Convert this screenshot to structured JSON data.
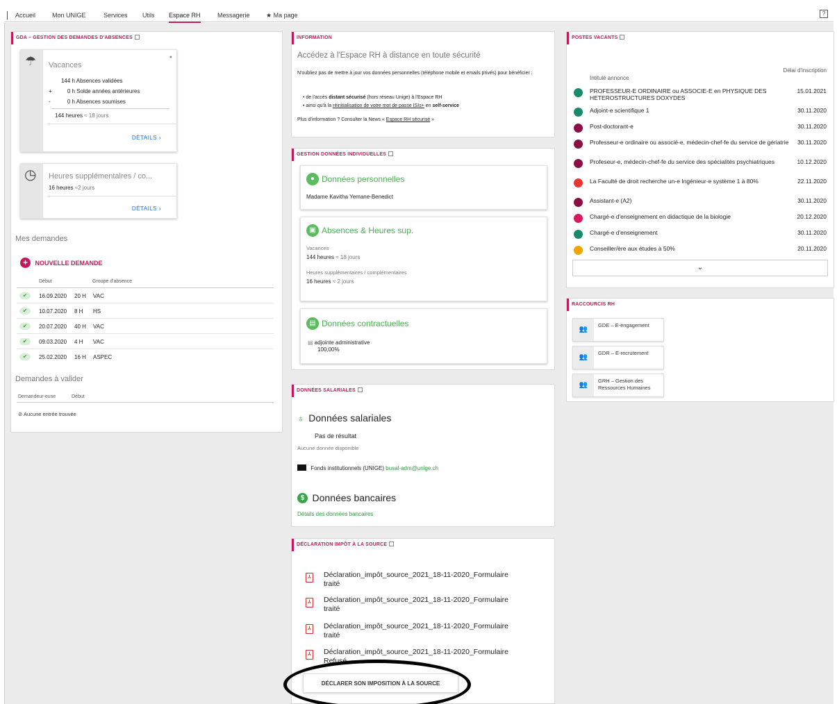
{
  "nav": {
    "items": [
      "Accueil",
      "Mon UNIGE",
      "Services",
      "Utils",
      "Espace RH",
      "Messagerie",
      "Ma page"
    ],
    "active": "Espace RH",
    "help_glyph": "?"
  },
  "gda": {
    "title": "GDA – GESTION DES DEMANDES D'ABSENCES",
    "vacances": {
      "title": "Vacances",
      "lines": [
        {
          "sign": "",
          "value": "144 h",
          "label": "Absences validées"
        },
        {
          "sign": "+",
          "value": "0 h",
          "label": "Solde années antérieures"
        },
        {
          "sign": "-",
          "value": "0 h",
          "label": "Absences soumises"
        }
      ],
      "total_hours": "144 heures",
      "total_days": "≈ 18 jours",
      "details": "DÉTAILS"
    },
    "heures": {
      "title": "Heures supplémentaires / co...",
      "hours": "16 heures",
      "days": "≈2 jours",
      "details": "DÉTAILS"
    },
    "mes_demandes": "Mes demandes",
    "nouvelle_demande": "NOUVELLE DEMANDE",
    "columns": [
      "Début",
      "Groupe d'absence"
    ],
    "rows": [
      {
        "date": "16.09.2020",
        "hours": "20 H",
        "group": "VAC"
      },
      {
        "date": "10.07.2020",
        "hours": "8 H",
        "group": "HS"
      },
      {
        "date": "20.07.2020",
        "hours": "40 H",
        "group": "VAC"
      },
      {
        "date": "09.03.2020",
        "hours": "4 H",
        "group": "VAC"
      },
      {
        "date": "25.02.2020",
        "hours": "16 H",
        "group": "ASPEC"
      }
    ],
    "a_valider": "Demandes à valider",
    "valider_columns": [
      "Demandeur-euse",
      "Début"
    ],
    "aucune": "Aucune entrée trouvée"
  },
  "information": {
    "title": "INFORMATION",
    "heading": "Accédez à l'Espace RH à distance en toute sécurité",
    "para": "N'oubliez pas de mettre à jour vos données personnelles (téléphone mobile et emails privés) pour bénéficier :",
    "bullet1_pre": "de l'accès ",
    "bullet1_bold": "distant sécurisé",
    "bullet1_post": " (hors réseau Unige) à l'Espace RH",
    "bullet2_pre": "ainsi qu'à la ",
    "bullet2_link": "réinitialisation de votre mot de passe ISIs+",
    "bullet2_mid": " en ",
    "bullet2_bold": "self-service",
    "more_pre": "Plus d'information ? Consulter la News « ",
    "more_link": "Espace RH sécurisé",
    "more_post": " »"
  },
  "gestion": {
    "title": "GESTION DONNÉES INDIVIDUELLES",
    "perso_title": "Données personnelles",
    "perso_name": "Madame Kavitha Yemane-Benedict",
    "abs_title": "Absences & Heures sup.",
    "abs_vac_label": "Vacances",
    "abs_vac_hours": "144 heures",
    "abs_vac_days": "≈ 18 jours",
    "abs_hs_label": "Heures supplémentaires / complémentaires",
    "abs_hs_hours": "16 heures",
    "abs_hs_days": "≈ 2 jours",
    "contrat_title": "Données contractuelles",
    "contrat_role": "adjointe administrative",
    "contrat_taux": "100,00%"
  },
  "salariales": {
    "title": "DONNÉES SALARIALES",
    "heading": "Données salariales",
    "no_result": "Pas de résultat",
    "no_data": "Aucune donnée disponible",
    "fonds_label": "Fonds institutionnels (UNIGE)",
    "fonds_email": "busal-adm@unige.ch",
    "banc_heading": "Données bancaires",
    "banc_link": "Détails des données bancaires"
  },
  "impot": {
    "title": "DÉCLARATION IMPÔT À LA SOURCE",
    "items": [
      {
        "name": "Déclaration_impôt_source_2021_18-11-2020_Formulaire",
        "status": "traité"
      },
      {
        "name": "Déclaration_impôt_source_2021_18-11-2020_Formulaire",
        "status": "traité"
      },
      {
        "name": "Déclaration_impôt_source_2021_18-11-2020_Formulaire",
        "status": "traité"
      },
      {
        "name": "Déclaration_impôt_source_2021_18-11-2020_Formulaire",
        "status": "Refusé"
      }
    ],
    "button": "DÉCLARER SON IMPOSITION À LA SOURCE"
  },
  "postes": {
    "title": "POSTES VACANTS",
    "col_title": "Intitulé annonce",
    "col_date": "Délai d'inscription",
    "jobs": [
      {
        "title": "PROFESSEUR-E ORDINAIRE ou ASSOCIE-E en PHYSIQUE DES HETEROSTRUCTURES DOXYDES",
        "date": "15.01.2021",
        "color": "#1a8a6e"
      },
      {
        "title": "Adjoint-e scientifique 1",
        "date": "30.11.2020",
        "color": "#1a8a6e"
      },
      {
        "title": "Post-doctorant-e",
        "date": "30.11.2020",
        "color": "#8b0f45"
      },
      {
        "title": "Professeur-e ordinaire ou associé-e, médecin-chef-fe du service de gériatrie",
        "date": "30.11.2020",
        "color": "#8b0f45"
      },
      {
        "title": "Profeseur-e, médecin-chef-fe du service des spécialités psychiatriques",
        "date": "10.12.2020",
        "color": "#8b0f45"
      },
      {
        "title": "La Faculté de droit recherche un-e Ingénieur-e système 1 à 80%",
        "date": "22.11.2020",
        "color": "#e53935"
      },
      {
        "title": "Assistant-e (A2)",
        "date": "30.11.2020",
        "color": "#8b0f45"
      },
      {
        "title": "Chargé-e d'enseignement en didactique de la biologie",
        "date": "20.12.2020",
        "color": "#d81b60"
      },
      {
        "title": "Chargé-e d'enseignement",
        "date": "30.11.2020",
        "color": "#1a8a6e"
      },
      {
        "title": "Conseiller/ère aux études à 50%",
        "date": "20.11.2020",
        "color": "#f0a500"
      }
    ]
  },
  "raccourcis": {
    "title": "RACCOURCIS RH",
    "items": [
      "GDE – E-engagement",
      "GDR – E-recrutement",
      "GRH – Gestion des Ressources Humaines"
    ]
  }
}
